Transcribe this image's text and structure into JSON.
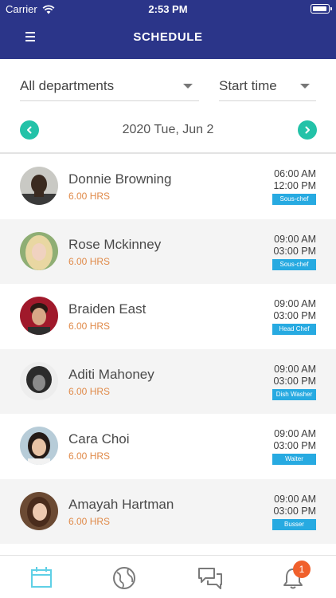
{
  "status_bar": {
    "carrier": "Carrier",
    "time": "2:53 PM"
  },
  "header": {
    "title": "SCHEDULE",
    "menu_icon": "hamburger-icon"
  },
  "filters": {
    "department": "All departments",
    "sort": "Start time"
  },
  "date_nav": {
    "date": "2020 Tue, Jun 2"
  },
  "colors": {
    "header": "#2b3589",
    "nav_accent": "#23c2a8",
    "hours": "#e08a49",
    "role_badge": "#27aae1",
    "notification": "#f0602c"
  },
  "employees": [
    {
      "name": "Donnie Browning",
      "hours": "6.00 HRS",
      "start": "06:00 AM",
      "end": "12:00 PM",
      "role": "Sous-chef"
    },
    {
      "name": "Rose Mckinney",
      "hours": "6.00 HRS",
      "start": "09:00 AM",
      "end": "03:00 PM",
      "role": "Sous-chef"
    },
    {
      "name": "Braiden East",
      "hours": "6.00 HRS",
      "start": "09:00 AM",
      "end": "03:00 PM",
      "role": "Head Chef"
    },
    {
      "name": "Aditi Mahoney",
      "hours": "6.00 HRS",
      "start": "09:00 AM",
      "end": "03:00 PM",
      "role": "Dish Washer"
    },
    {
      "name": "Cara Choi",
      "hours": "6.00 HRS",
      "start": "09:00 AM",
      "end": "03:00 PM",
      "role": "Waiter"
    },
    {
      "name": "Amayah Hartman",
      "hours": "6.00 HRS",
      "start": "09:00 AM",
      "end": "03:00 PM",
      "role": "Busser"
    }
  ],
  "tab_bar": {
    "tabs": [
      "calendar-icon",
      "globe-icon",
      "chat-icon",
      "bell-icon"
    ],
    "notification_count": "1"
  }
}
